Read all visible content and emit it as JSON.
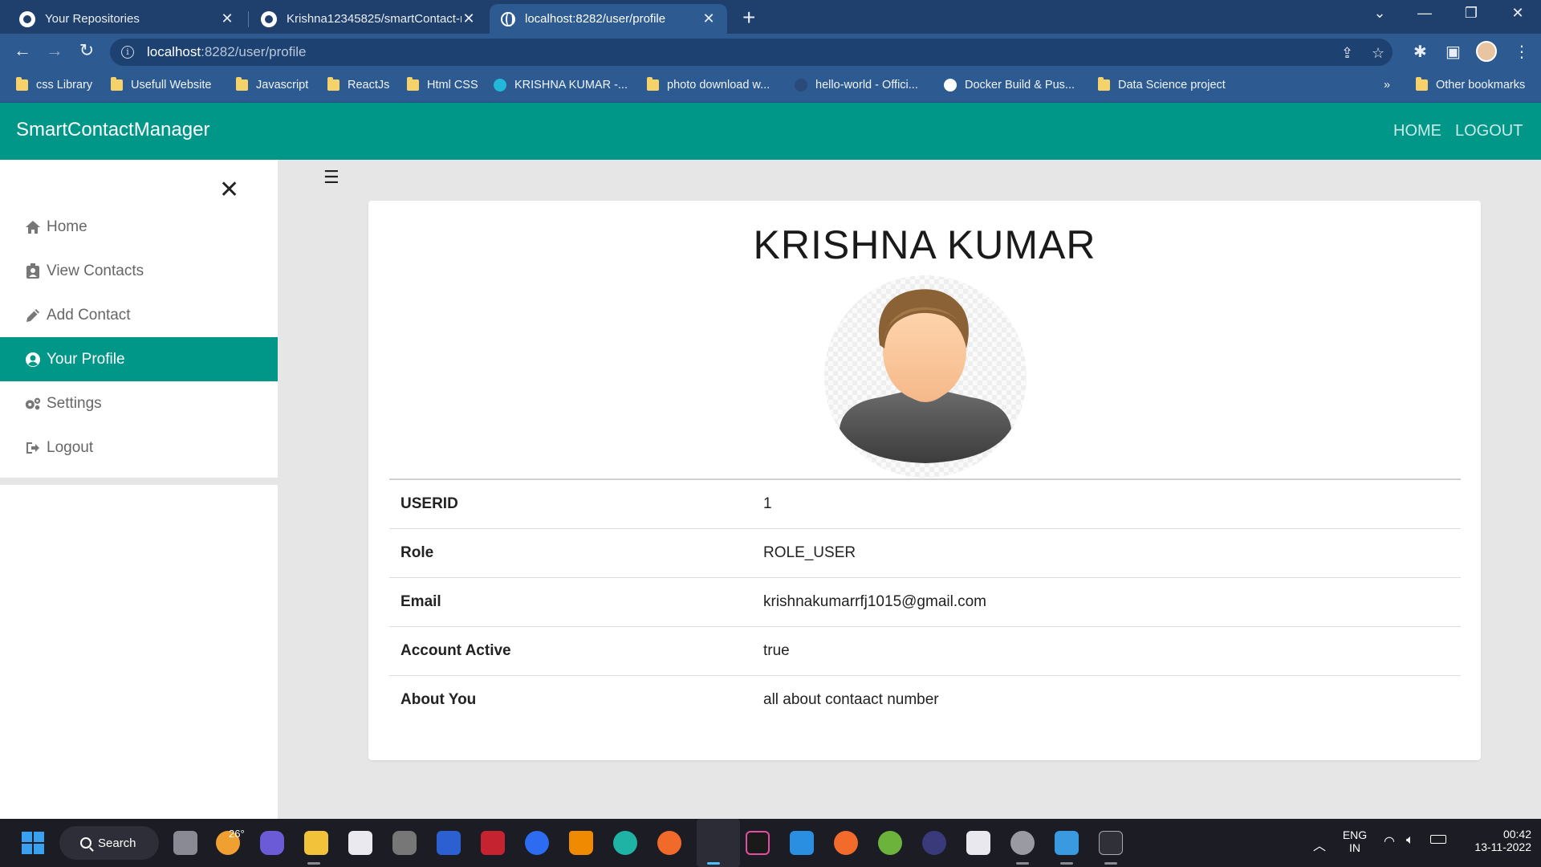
{
  "browser": {
    "tabs": [
      {
        "title": "Your Repositories",
        "active": false
      },
      {
        "title": "Krishna12345825/smartContact-r",
        "active": false
      },
      {
        "title": "localhost:8282/user/profile",
        "active": true
      }
    ],
    "url_host": "localhost",
    "url_rest": ":8282/user/profile",
    "bookmarks": [
      {
        "label": "css Library",
        "icon": "folder-icon"
      },
      {
        "label": "Usefull Website",
        "icon": "folder-icon"
      },
      {
        "label": "Javascript",
        "icon": "folder-icon"
      },
      {
        "label": "ReactJs",
        "icon": "folder-icon"
      },
      {
        "label": "Html CSS",
        "icon": "folder-icon"
      },
      {
        "label": "KRISHNA KUMAR -...",
        "icon": "canva-icon"
      },
      {
        "label": "photo download w...",
        "icon": "folder-icon"
      },
      {
        "label": "hello-world - Offici...",
        "icon": "docker-icon"
      },
      {
        "label": "Docker Build & Pus...",
        "icon": "github-icon"
      },
      {
        "label": "Data Science project",
        "icon": "folder-icon"
      }
    ],
    "more_bookmarks": "»",
    "other_bookmarks": "Other bookmarks"
  },
  "app": {
    "brand": "SmartContactManager",
    "nav": {
      "home": "HOME",
      "logout": "LOGOUT"
    },
    "sidebar": {
      "items": [
        {
          "label": "Home",
          "icon": "home-icon",
          "active": false
        },
        {
          "label": "View Contacts",
          "icon": "address-book-icon",
          "active": false
        },
        {
          "label": "Add Contact",
          "icon": "pencil-icon",
          "active": false
        },
        {
          "label": "Your Profile",
          "icon": "user-circle-icon",
          "active": true
        },
        {
          "label": "Settings",
          "icon": "gears-icon",
          "active": false
        },
        {
          "label": "Logout",
          "icon": "sign-out-icon",
          "active": false
        }
      ]
    },
    "profile": {
      "name": "KRISHNA KUMAR",
      "details": [
        {
          "key": "USERID",
          "value": "1"
        },
        {
          "key": "Role",
          "value": "ROLE_USER"
        },
        {
          "key": "Email",
          "value": "krishnakumarrfj1015@gmail.com"
        },
        {
          "key": "Account Active",
          "value": "true"
        },
        {
          "key": "About You",
          "value": "all about contaact number"
        }
      ]
    }
  },
  "taskbar": {
    "search_label": "Search",
    "weather": "26°",
    "lang_top": "ENG",
    "lang_bottom": "IN",
    "time": "00:42",
    "date": "13-11-2022"
  },
  "colors": {
    "accent": "#009688",
    "browser_frame": "#1f3f6c",
    "browser_toolbar": "#2c5a91"
  }
}
